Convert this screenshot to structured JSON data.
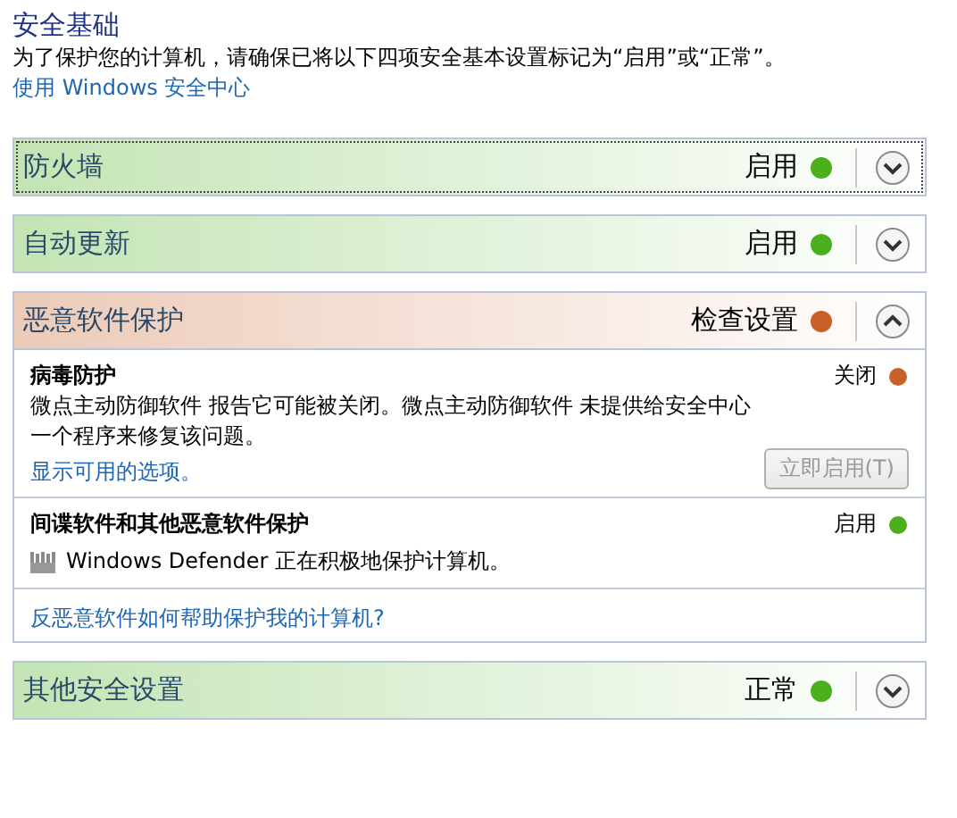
{
  "heading": "安全基础",
  "description": "为了保护您的计算机，请确保已将以下四项安全基本设置标记为“启用”或“正常”。",
  "link": "使用 Windows 安全中心",
  "sections": [
    {
      "title": "防火墙",
      "status": "启用",
      "color": "#4caf1e",
      "expanded": false,
      "focused": true
    },
    {
      "title": "自动更新",
      "status": "启用",
      "color": "#4caf1e",
      "expanded": false,
      "focused": false
    },
    {
      "title": "恶意软件保护",
      "status": "检查设置",
      "color": "#c8602a",
      "expanded": true,
      "focused": false,
      "items": [
        {
          "title": "病毒防护",
          "status": "关闭",
          "color": "#c8602a",
          "lines": [
            "微点主动防御软件 报告它可能被关闭。微点主动防御软件 未提供给安全中心",
            "一个程序来修复该问题。"
          ],
          "link": "显示可用的选项。",
          "button": {
            "label": "立即启用(T)",
            "disabled": true
          }
        },
        {
          "title": "间谍软件和其他恶意软件保护",
          "status": "启用",
          "color": "#4caf1e",
          "product": "Windows Defender 正在积极地保护计算机。"
        }
      ],
      "footer_link": "反恶意软件如何帮助保护我的计算机?"
    },
    {
      "title": "其他安全设置",
      "status": "正常",
      "color": "#4caf1e",
      "expanded": false,
      "focused": false
    }
  ]
}
